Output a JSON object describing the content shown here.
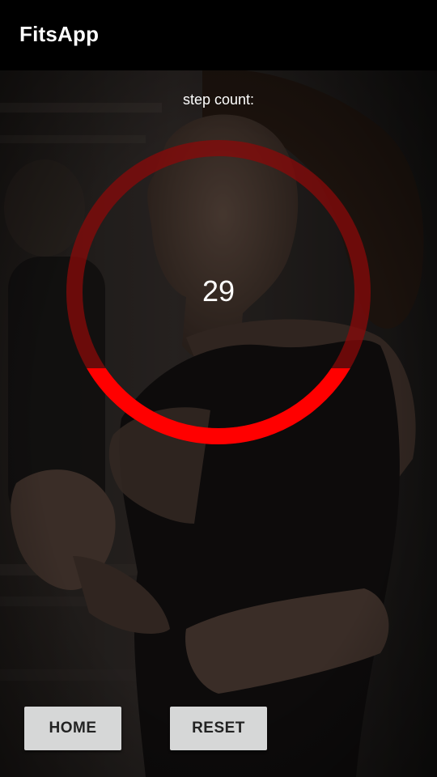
{
  "appbar": {
    "title": "FitsApp"
  },
  "background": {
    "description_icon": "runner-photo"
  },
  "step_counter": {
    "label": "step count:",
    "value": "29",
    "progress_fraction": 0.25,
    "ring_color": "#ff0000",
    "track_color": "#8a0a0a"
  },
  "buttons": {
    "home_label": "HOME",
    "reset_label": "RESET"
  }
}
